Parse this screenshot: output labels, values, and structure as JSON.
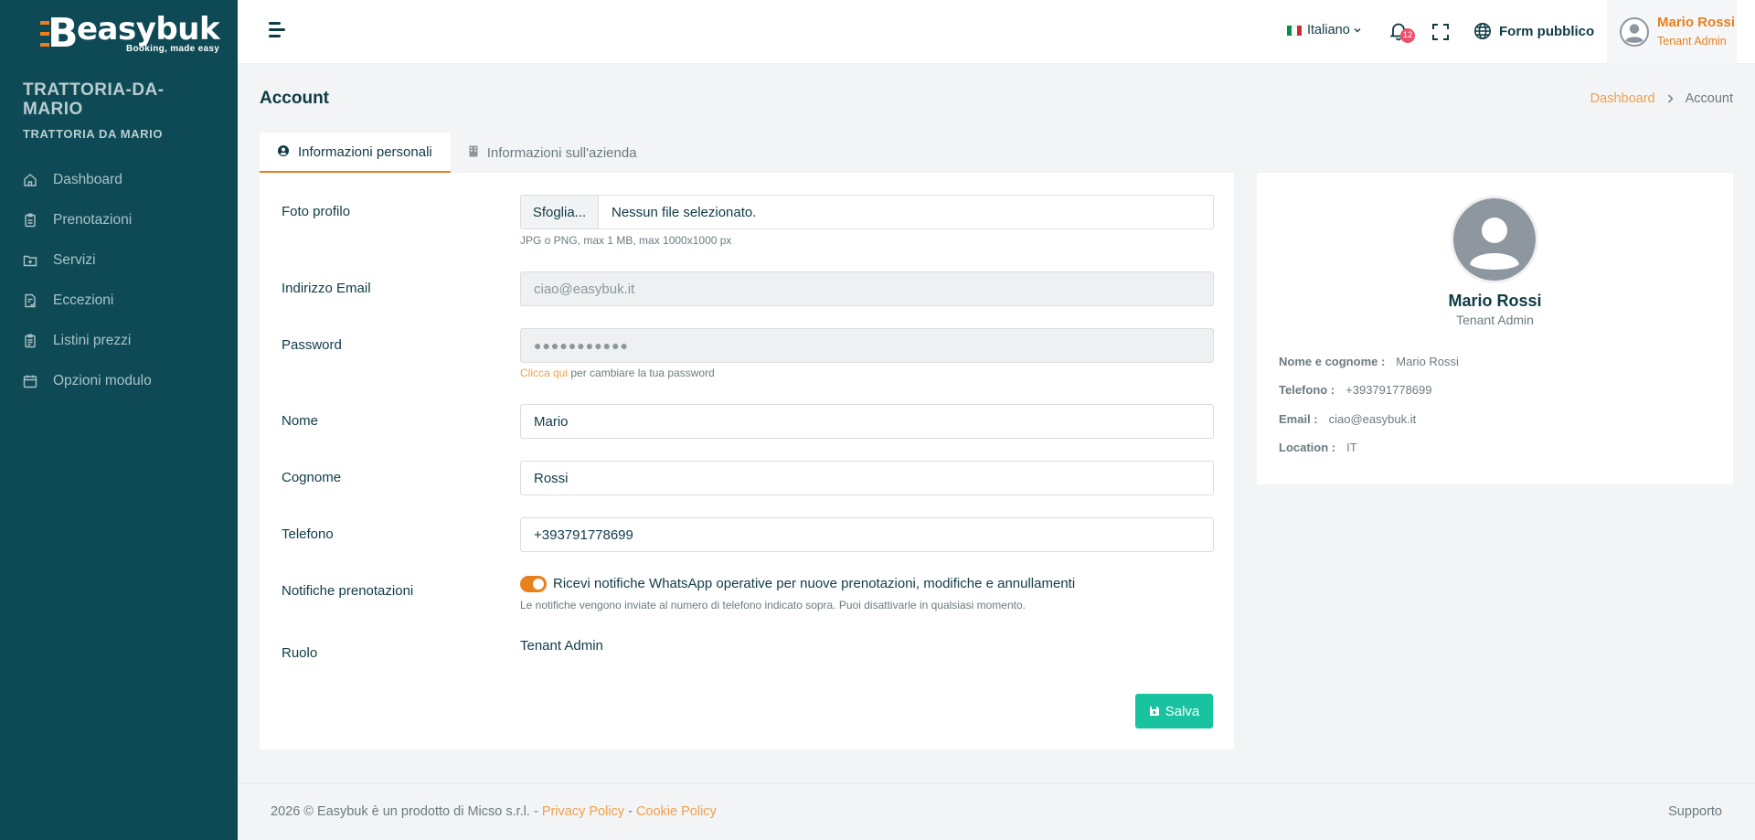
{
  "brand": {
    "name": "easybuk",
    "tagline": "Booking, made easy",
    "accent": "#e8801c",
    "sidebar_bg": "#0e4a55"
  },
  "tenant": {
    "name": "TRATTORIA-DA-MARIO",
    "subtitle": "TRATTORIA DA MARIO"
  },
  "sidebar": {
    "items": [
      {
        "label": "Dashboard",
        "icon": "home-icon"
      },
      {
        "label": "Prenotazioni",
        "icon": "clipboard-icon"
      },
      {
        "label": "Servizi",
        "icon": "folder-plus-icon"
      },
      {
        "label": "Eccezioni",
        "icon": "document-check-icon"
      },
      {
        "label": "Listini prezzi",
        "icon": "clipboard-list-icon"
      },
      {
        "label": "Opzioni modulo",
        "icon": "calendar-icon"
      }
    ]
  },
  "header": {
    "language": "Italiano",
    "notifications_count": "12",
    "public_form": "Form pubblico",
    "user_name": "Mario Rossi",
    "user_role": "Tenant Admin"
  },
  "page": {
    "title": "Account"
  },
  "breadcrumb": {
    "home": "Dashboard",
    "current": "Account"
  },
  "tabs": [
    {
      "label": "Informazioni personali",
      "active": true
    },
    {
      "label": "Informazioni sull'azienda",
      "active": false
    }
  ],
  "form": {
    "photo": {
      "label": "Foto profilo",
      "button": "Sfoglia...",
      "file_text": "Nessun file selezionato.",
      "hint": "JPG o PNG, max 1 MB, max 1000x1000 px"
    },
    "email": {
      "label": "Indirizzo Email",
      "value": "ciao@easybuk.it"
    },
    "password": {
      "label": "Password",
      "value": "●●●●●●●●●●●",
      "hint_link": "Clicca qui",
      "hint_text": " per cambiare la tua password"
    },
    "first_name": {
      "label": "Nome",
      "value": "Mario"
    },
    "last_name": {
      "label": "Cognome",
      "value": "Rossi"
    },
    "phone": {
      "label": "Telefono",
      "value": "+393791778699"
    },
    "notifications": {
      "label": "Notifiche prenotazioni",
      "toggle_label": "Ricevi notifiche WhatsApp operative per nuove prenotazioni, modifiche e annullamenti",
      "enabled": true,
      "hint": "Le notifiche vengono inviate al numero di telefono indicato sopra. Puoi disattivarle in qualsiasi momento."
    },
    "role": {
      "label": "Ruolo",
      "value": "Tenant Admin"
    },
    "save": "Salva"
  },
  "profile": {
    "name": "Mario Rossi",
    "role": "Tenant Admin",
    "rows": [
      {
        "key": "Nome e cognome :",
        "value": "Mario Rossi"
      },
      {
        "key": "Telefono :",
        "value": "+393791778699"
      },
      {
        "key": "Email :",
        "value": "ciao@easybuk.it"
      },
      {
        "key": "Location :",
        "value": "IT"
      }
    ]
  },
  "footer": {
    "copyright": "2026 © Easybuk è un prodotto di Micso s.r.l. - ",
    "privacy": "Privacy Policy",
    "dash": " - ",
    "cookie": "Cookie Policy",
    "support": "Supporto"
  }
}
